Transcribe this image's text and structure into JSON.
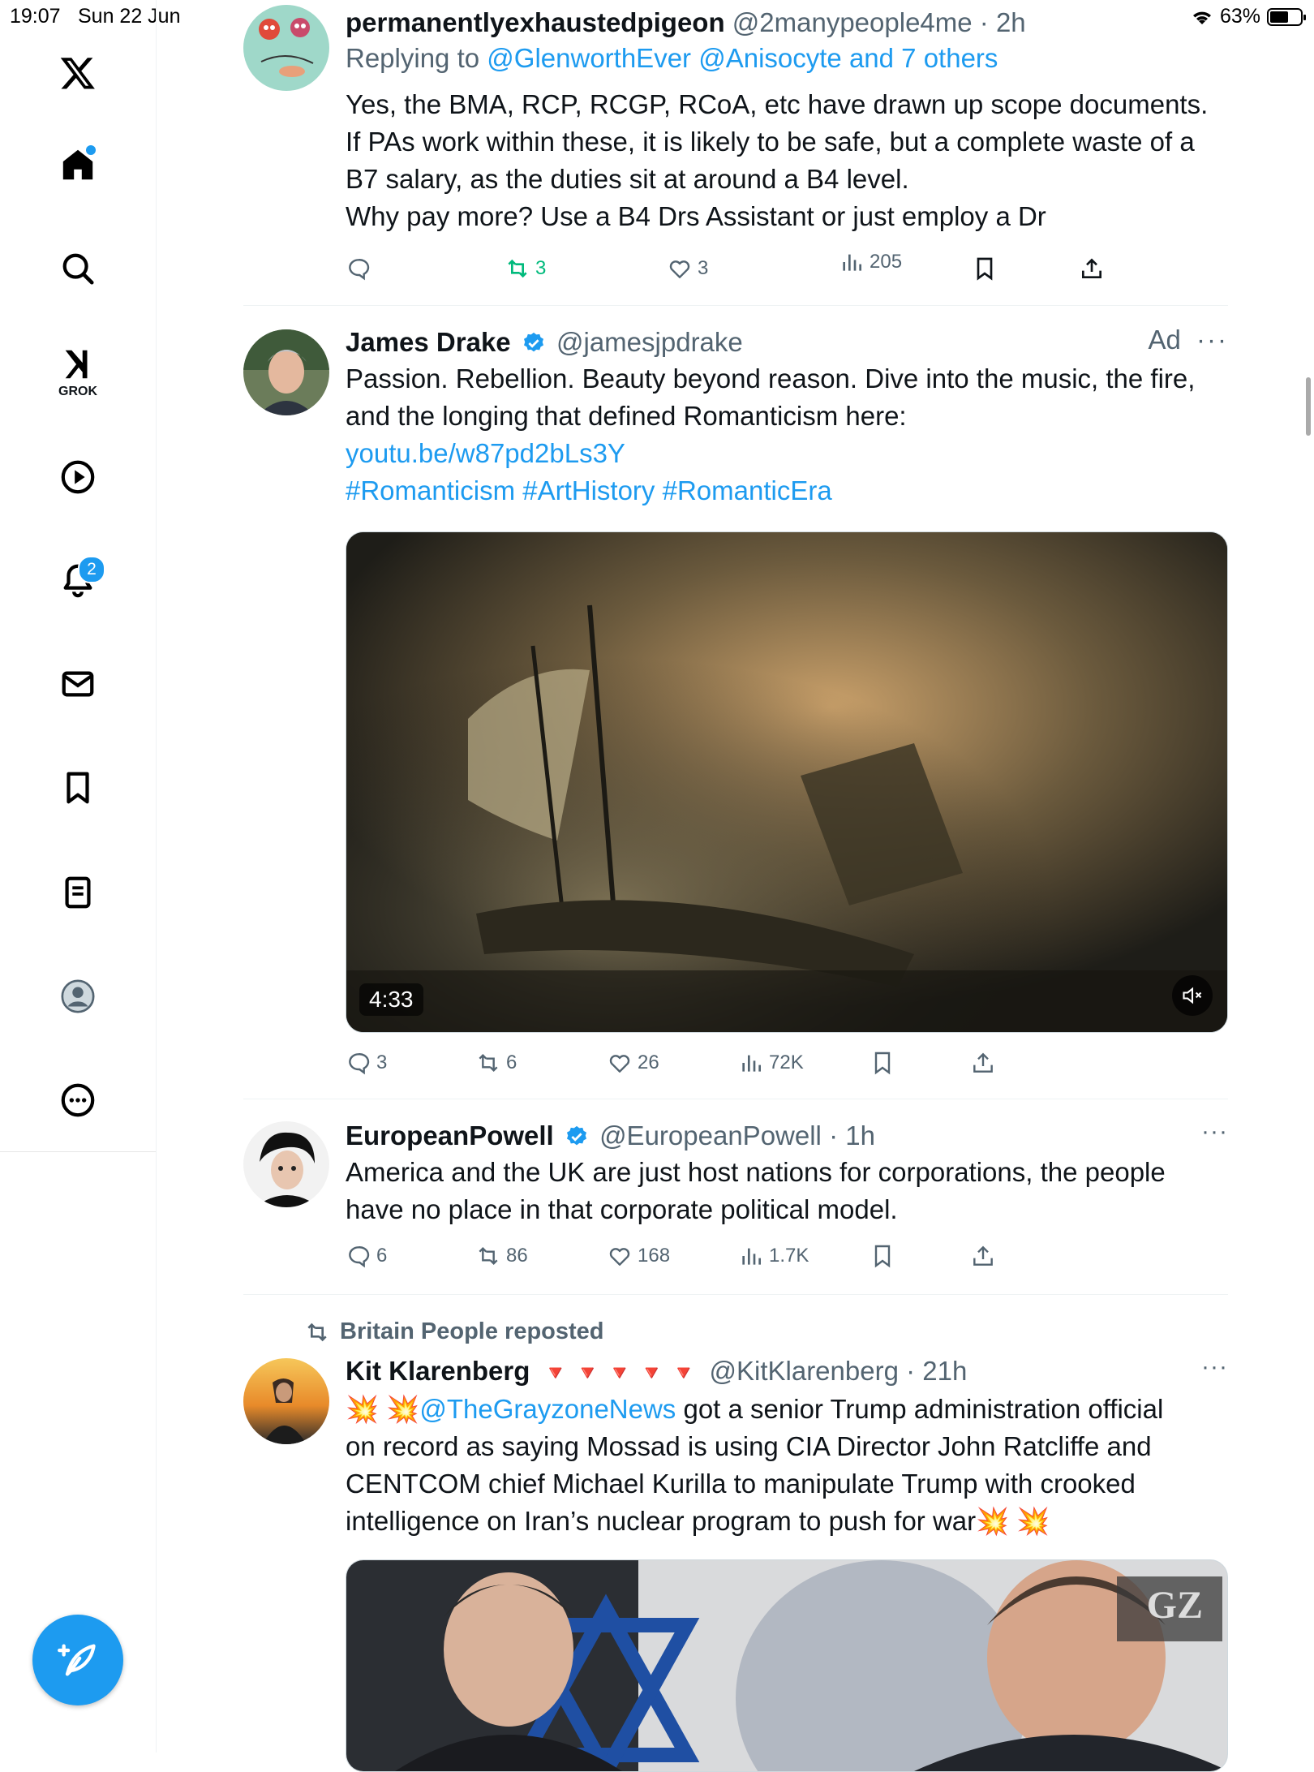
{
  "status_bar": {
    "time": "19:07",
    "date": "Sun 22 Jun",
    "battery": "63%"
  },
  "sidebar": {
    "items": [
      {
        "name": "x-logo"
      },
      {
        "name": "home"
      },
      {
        "name": "search"
      },
      {
        "name": "grok",
        "label": "GROK"
      },
      {
        "name": "video"
      },
      {
        "name": "notifications",
        "badge": "2"
      },
      {
        "name": "messages"
      },
      {
        "name": "bookmarks"
      },
      {
        "name": "lists"
      },
      {
        "name": "profile"
      },
      {
        "name": "more"
      }
    ]
  },
  "tweets": [
    {
      "display_name": "permanentlyexhaustedpigeon",
      "handle": "@2manypeople4me",
      "time": "· 2h",
      "replying_prefix": "Replying to",
      "replying_to": "@GlenworthEver @Anisocyte and 7 others",
      "text_lines": [
        "Yes, the BMA, RCP, RCGP, RCoA, etc have drawn up scope documents.",
        "If PAs work within these, it is likely to be safe, but a complete waste of a",
        "B7 salary, as the duties sit at around a B4 level.",
        "Why pay more? Use a B4 Drs Assistant or just employ a Dr"
      ],
      "reply_count": "",
      "repost_count": "3",
      "like_count": "3",
      "view_count": "205"
    },
    {
      "display_name": "James Drake",
      "handle": "@jamesjpdrake",
      "ad_label": "Ad",
      "text_lines": [
        "Passion. Rebellion. Beauty beyond reason. Dive into the music, the fire,",
        "and the longing that defined Romanticism here:"
      ],
      "link": "youtu.be/w87pd2bLs3Y",
      "hashtags": "#Romanticism #ArtHistory #RomanticEra",
      "video_duration": "4:33",
      "reply_count": "3",
      "repost_count": "6",
      "like_count": "26",
      "view_count": "72K"
    },
    {
      "display_name": "EuropeanPowell",
      "handle": "@EuropeanPowell",
      "time": "· 1h",
      "text_lines": [
        "America and the UK are just host nations for corporations, the people",
        "have no place in that corporate political model."
      ],
      "reply_count": "6",
      "repost_count": "86",
      "like_count": "168",
      "view_count": "1.7K"
    },
    {
      "repost_by": "Britain People reposted",
      "display_name": "Kit Klarenberg",
      "name_emojis": "🔻 🔻 🔻 🔻 🔻",
      "handle": "@KitKlarenberg",
      "time": "· 21h",
      "burst_emojis": "💥 💥",
      "mention": "@TheGrayzoneNews",
      "line1_rest": " got a senior Trump administration official",
      "text_lines": [
        "on record as saying Mossad is using CIA Director John Ratcliffe and",
        "CENTCOM chief Michael Kurilla to manipulate Trump with crooked"
      ],
      "last_line": "intelligence on Iran’s nuclear program to push for war",
      "image_watermark": "GZ"
    }
  ],
  "colors": {
    "accent": "#1d9bf0",
    "repost_active": "#00ba7c",
    "secondary_text": "#536471"
  }
}
